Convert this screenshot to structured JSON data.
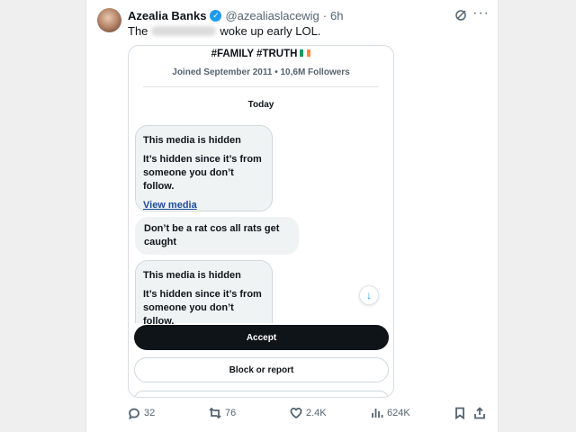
{
  "tweet": {
    "name": "Azealia Banks",
    "handle": "@azealiaslacewig",
    "separator": "·",
    "time": "6h",
    "text_before": "The",
    "text_after": "woke up early LOL."
  },
  "screenshot": {
    "title": "#FAMILY #TRUTH",
    "joined": "Joined September 2011 • 10,6M Followers",
    "day": "Today",
    "messages": [
      {
        "title": "This media is hidden",
        "body": "It’s hidden since it’s from someone you don’t follow.",
        "link": "View media"
      },
      {
        "text": "Don’t be a rat cos all rats get caught"
      },
      {
        "title": "This media is hidden",
        "body": "It’s hidden since it’s from someone you don’t follow."
      }
    ],
    "accept_label": "Accept",
    "block_label": "Block or report"
  },
  "actions": {
    "replies": "32",
    "reposts": "76",
    "likes": "2.4K",
    "views": "624K"
  },
  "colors": {
    "verified": "#1d9bf0",
    "link": "#1b4c9b",
    "button_dark": "#0f1419"
  },
  "icons": [
    "verified-badge-icon",
    "grok-icon",
    "more-icon",
    "arrow-down-icon",
    "reply-icon",
    "repost-icon",
    "like-icon",
    "views-icon",
    "bookmark-icon",
    "share-icon"
  ]
}
